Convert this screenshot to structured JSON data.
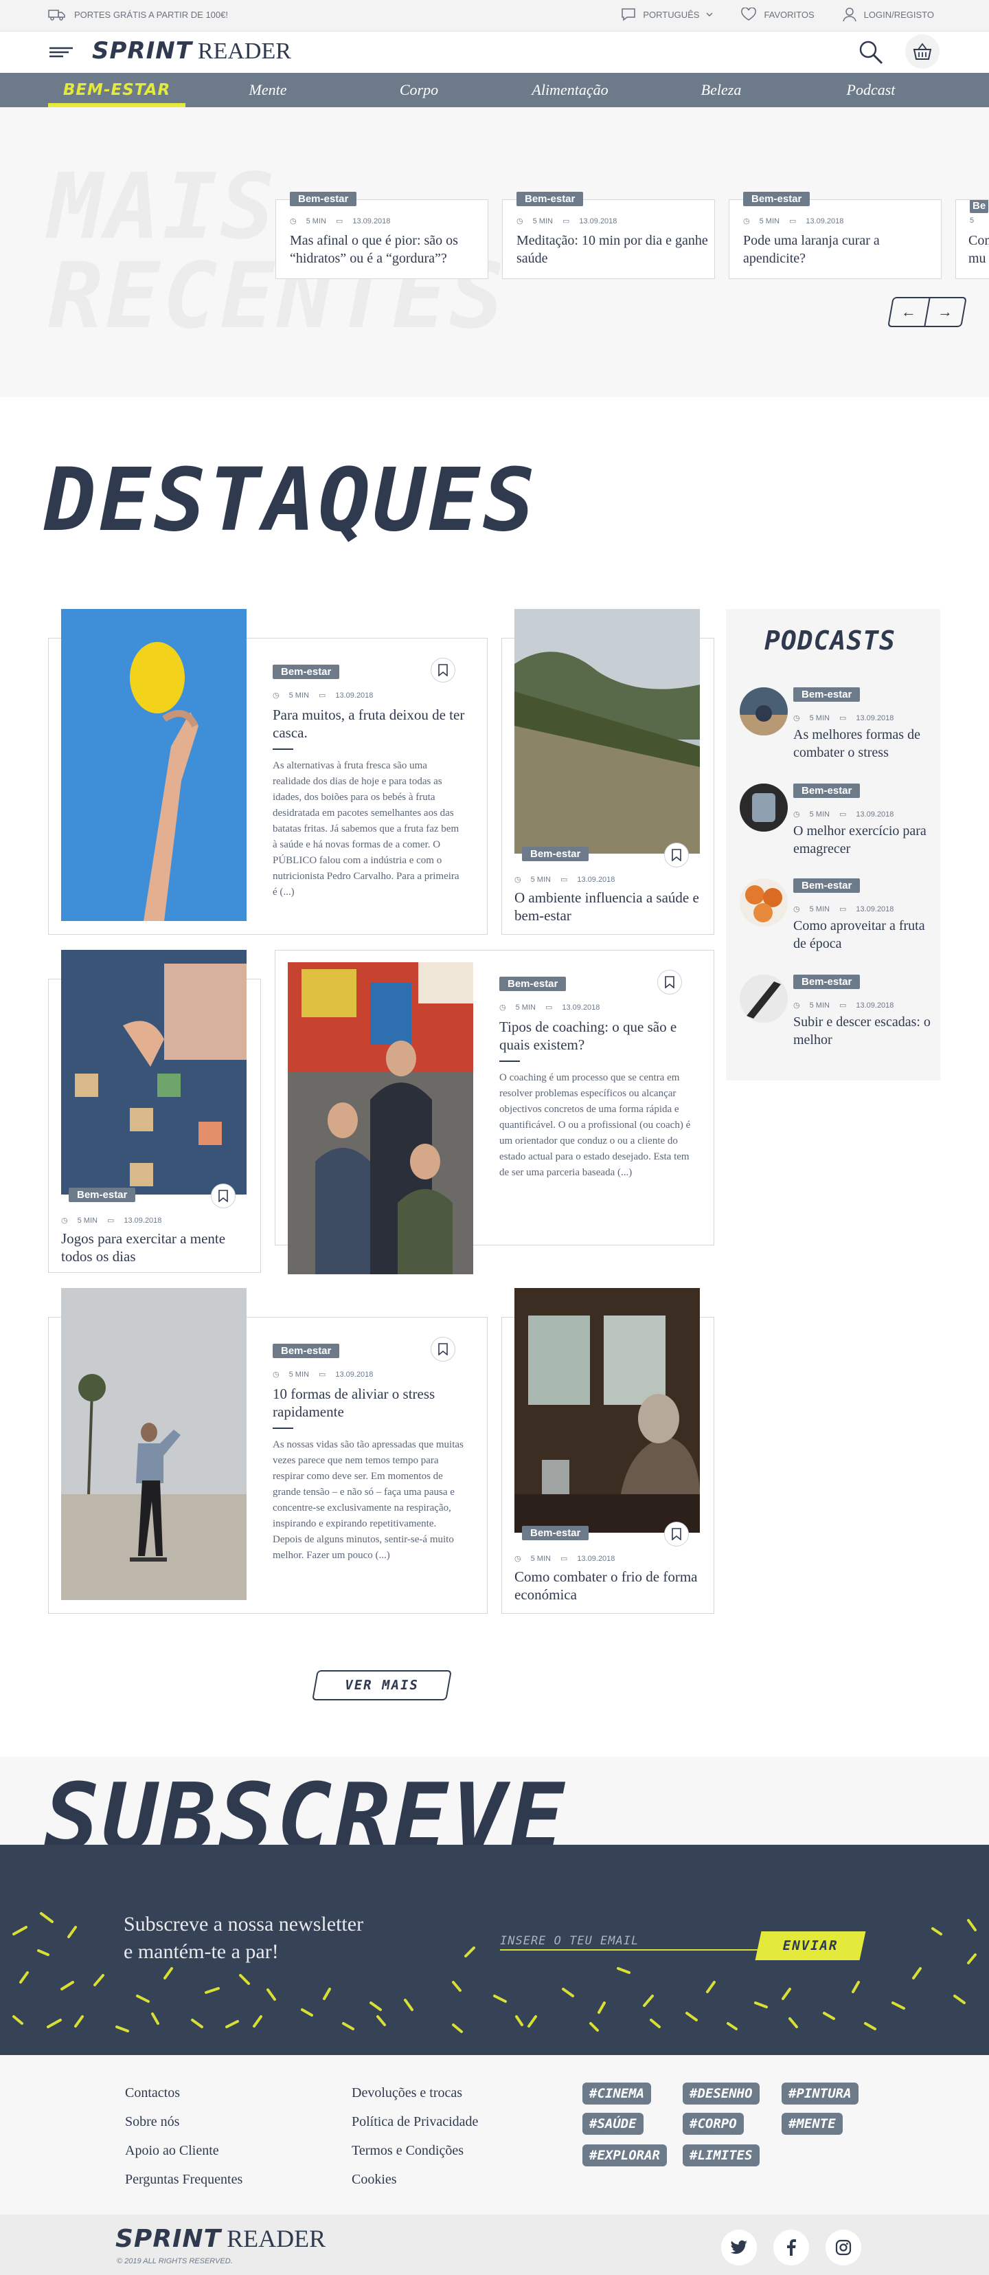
{
  "topbar": {
    "shipping": "PORTES GRÁTIS A PARTIR DE 100€!",
    "language": "PORTUGUÊS",
    "favorites": "FAVORITOS",
    "login": "LOGIN/REGISTO"
  },
  "header": {
    "logo_bold": "SPRINT",
    "logo_light": "READER"
  },
  "nav": {
    "items": [
      "BEM-ESTAR",
      "Mente",
      "Corpo",
      "Alimentação",
      "Beleza",
      "Podcast"
    ]
  },
  "recent": {
    "ghost_line1": "MAIS",
    "ghost_line2": "RECENTES",
    "cards": [
      {
        "category": "Bem-estar",
        "read": "5 MIN",
        "date": "13.09.2018",
        "title": "Mas afinal o que é pior: são os “hidratos” ou é a “gordura”?"
      },
      {
        "category": "Bem-estar",
        "read": "5 MIN",
        "date": "13.09.2018",
        "title": "Meditação: 10 min por dia e ganhe saúde"
      },
      {
        "category": "Bem-estar",
        "read": "5 MIN",
        "date": "13.09.2018",
        "title": "Pode uma laranja curar a apendicite?"
      },
      {
        "category": "Be",
        "read": "5",
        "date": "",
        "title": "Com mu"
      }
    ]
  },
  "featured": {
    "heading": "DESTAQUES",
    "articles": [
      {
        "category": "Bem-estar",
        "read": "5 MIN",
        "date": "13.09.2018",
        "title": "Para muitos, a fruta deixou de ter casca.",
        "excerpt": "As alternativas à fruta fresca são uma realidade dos dias de hoje e para todas as idades, dos boiões para os bebés à fruta desidratada em pacotes semelhantes aos das batatas fritas. Já sabemos que a fruta faz bem à saúde e há novas formas de a comer. O PÚBLICO falou com a indústria e com o nutricionista Pedro Carvalho. Para a primeira é (...)"
      },
      {
        "category": "Bem-estar",
        "read": "5 MIN",
        "date": "13.09.2018",
        "title": "O ambiente influencia a saúde e bem-estar"
      },
      {
        "category": "Bem-estar",
        "read": "5 MIN",
        "date": "13.09.2018",
        "title": "Jogos para exercitar a mente todos os dias"
      },
      {
        "category": "Bem-estar",
        "read": "5 MIN",
        "date": "13.09.2018",
        "title": "Tipos de coaching: o que são e quais existem?",
        "excerpt": "O coaching é um processo que se centra em resolver problemas específicos ou alcançar objectivos concretos de uma forma rápida e quantificável. O ou a profissional (ou coach) é um orientador que conduz o ou a cliente do estado actual para o estado desejado. Esta tem de ser uma parceria baseada (...)"
      },
      {
        "category": "Bem-estar",
        "read": "5 MIN",
        "date": "13.09.2018",
        "title": "10 formas de aliviar o stress rapidamente",
        "excerpt": "As nossas vidas são tão apressadas que muitas vezes parece que nem temos tempo para respirar como deve ser. Em momentos de grande tensão – e não só – faça uma pausa e concentre-se exclusivamente na respiração, inspirando e expirando repetitivamente. Depois de alguns minutos, sentir-se-á muito melhor. Fazer um pouco (...)"
      },
      {
        "category": "Bem-estar",
        "read": "5 MIN",
        "date": "13.09.2018",
        "title": "Como combater o frio de forma económica"
      }
    ],
    "more_button": "VER MAIS"
  },
  "podcasts": {
    "heading": "PODCASTS",
    "items": [
      {
        "category": "Bem-estar",
        "read": "5 MIN",
        "date": "13.09.2018",
        "title": "As melhores formas de combater o stress"
      },
      {
        "category": "Bem-estar",
        "read": "5 MIN",
        "date": "13.09.2018",
        "title": "O melhor exercício para emagrecer"
      },
      {
        "category": "Bem-estar",
        "read": "5 MIN",
        "date": "13.09.2018",
        "title": "Como aproveitar a fruta de época"
      },
      {
        "category": "Bem-estar",
        "read": "5 MIN",
        "date": "13.09.2018",
        "title": "Subir e descer escadas: o melhor"
      }
    ]
  },
  "subscribe": {
    "heading": "SUBSCREVE",
    "text_line1": "Subscreve a nossa newsletter",
    "text_line2": "e mantém-te a par!",
    "email_placeholder": "INSERE O TEU EMAIL",
    "send": "ENVIAR"
  },
  "footer": {
    "col1": [
      "Contactos",
      "Sobre nós",
      "Apoio ao Cliente",
      "Perguntas Frequentes"
    ],
    "col2": [
      "Devoluções e trocas",
      "Política de Privacidade",
      "Termos e Condições",
      "Cookies"
    ],
    "tags": [
      "#CINEMA",
      "#DESENHO",
      "#PINTURA",
      "#SAÚDE",
      "#CORPO",
      "#MENTE",
      "#EXPLORAR",
      "#LIMITES"
    ],
    "logo_bold": "SPRINT",
    "logo_light": "READER",
    "copyright": "© 2019 ALL RIGHTS RESERVED."
  },
  "colors": {
    "accent": "#e3ea3b",
    "navy": "#2f3a4f",
    "slate": "#6c7a8a"
  }
}
